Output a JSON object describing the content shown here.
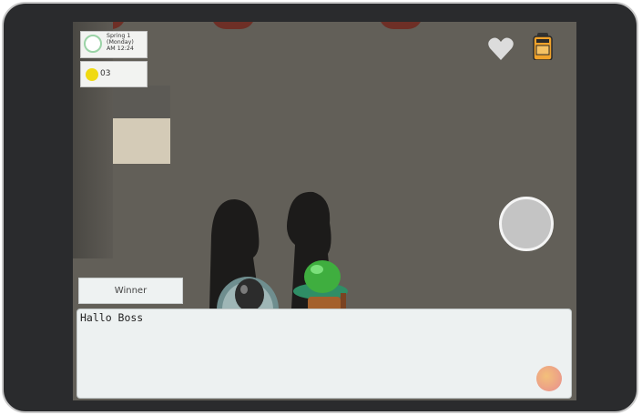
{
  "hud": {
    "season": "Spring 1",
    "weekday": "(Monday)",
    "time": "AM 12:24",
    "money": "03"
  },
  "icons": {
    "heart": "heart-icon",
    "backpack": "backpack-icon",
    "clock": "clock-icon",
    "coin": "coin-icon"
  },
  "npc": {
    "name": "Winner"
  },
  "dialog": {
    "text": "Hallo Boss"
  },
  "colors": {
    "floor": "#625f58",
    "panel": "#f2f3f1",
    "coin": "#f0da12",
    "player_cap": "#3fae3f"
  }
}
